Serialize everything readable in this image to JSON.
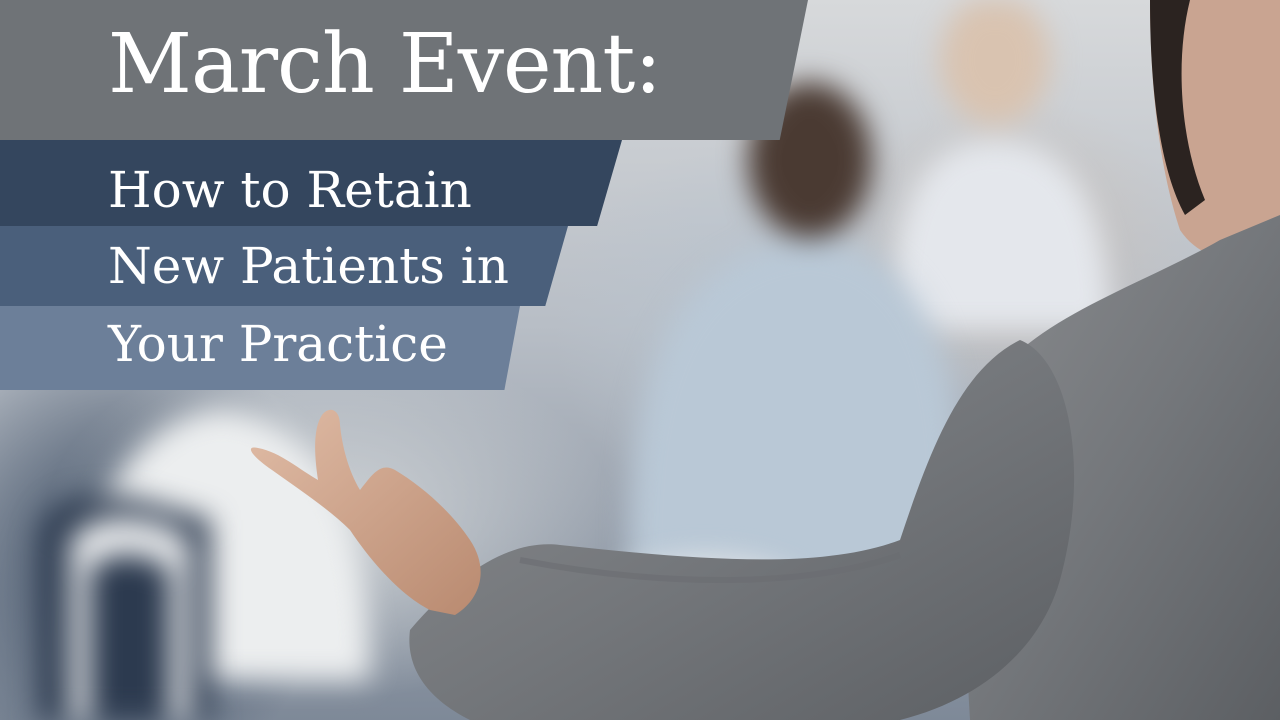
{
  "banner": {
    "title": "March Event:",
    "subtitle_lines": [
      "How to Retain",
      "New Patients in",
      "Your Practice"
    ]
  },
  "colors": {
    "title_band": "#6f7377",
    "line_band_1": "#34465e",
    "line_band_2": "#4a5f7b",
    "line_band_3": "#6c7f99",
    "text": "#ffffff"
  }
}
